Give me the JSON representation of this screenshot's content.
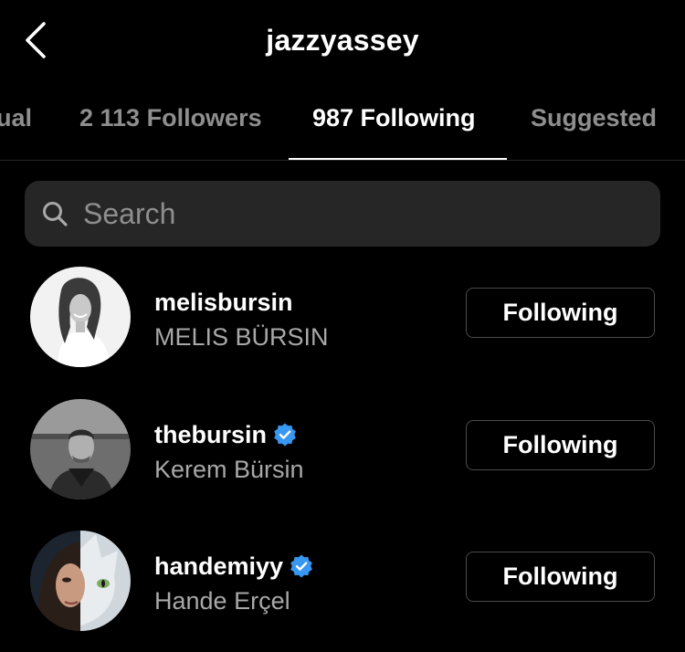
{
  "header": {
    "title": "jazzyassey",
    "back_icon": "chevron-left-icon"
  },
  "tabs": [
    {
      "label": "ual"
    },
    {
      "label": "2 113 Followers"
    },
    {
      "label": "987 Following",
      "active": true
    },
    {
      "label": "Suggested"
    }
  ],
  "search": {
    "placeholder": "Search",
    "icon": "search-icon"
  },
  "users": [
    {
      "username": "melisbursin",
      "full_name": "MELIS BÜRSIN",
      "verified": false,
      "button_label": "Following"
    },
    {
      "username": "thebursin",
      "full_name": "Kerem Bürsin",
      "verified": true,
      "button_label": "Following"
    },
    {
      "username": "handemiyy",
      "full_name": "Hande Erçel",
      "verified": true,
      "button_label": "Following"
    }
  ],
  "colors": {
    "background": "#000000",
    "secondary_text": "#8e8e8e",
    "search_bg": "#262626",
    "verified_blue": "#3897f0"
  }
}
